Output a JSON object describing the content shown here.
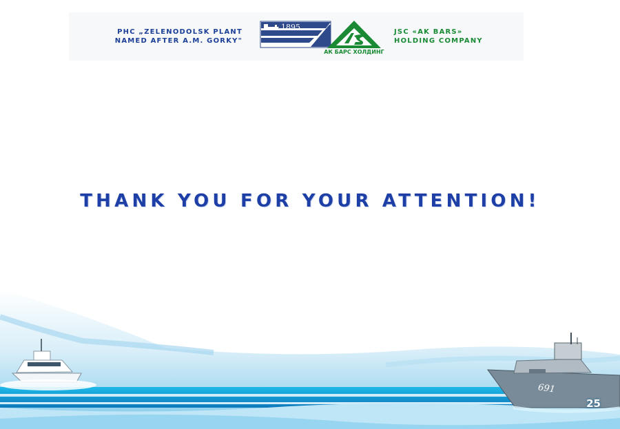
{
  "header": {
    "left_caption_line1": "PHC „Zelenodolsk plant",
    "left_caption_line2": "named after A.M. Gorky\"",
    "plant_logo_year": "1895",
    "akbars_logo_text": "АК БАРС ХОЛДИНГ",
    "right_caption_line1": "JSC «AK BARS»",
    "right_caption_line2": "HOLDING COMPANY"
  },
  "main": {
    "title": "THANK YOU FOR YOUR ATTENTION!"
  },
  "footer": {
    "ship_hull_number": "691",
    "slide_number": "25"
  },
  "colors": {
    "primary_blue": "#1d3fa6",
    "brand_green": "#1a8a34",
    "sea_cyan": "#2cc7ef"
  }
}
